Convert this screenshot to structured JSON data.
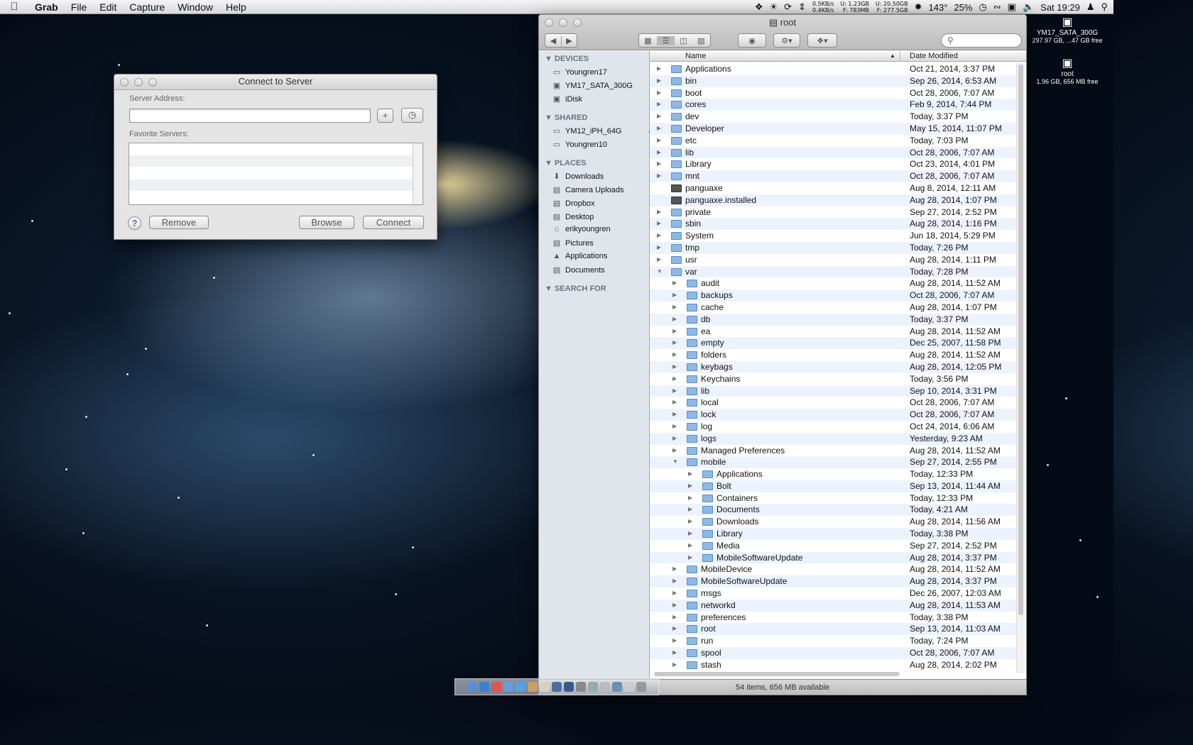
{
  "menubar": {
    "apple_icon": "apple-logo",
    "app_name": "Grab",
    "menus": [
      "File",
      "Edit",
      "Capture",
      "Window",
      "Help"
    ],
    "status": {
      "net_up": "0.5KB/s",
      "net_down": "0.4KB/s",
      "mem_u": "U:  1.23GB",
      "mem_f": "F:  783MB",
      "disk_u": "U:  20.50GB",
      "disk_f": "F:  277.5GB",
      "temp": "143°",
      "battery": "25%",
      "clock": "Sat 19:29"
    }
  },
  "desktop_icons": [
    {
      "name": "YM17_SATA_300G",
      "sub": "297.97 GB, ...47 GB free"
    },
    {
      "name": "root",
      "sub": "1.96 GB, 656 MB free"
    }
  ],
  "connect_dialog": {
    "title": "Connect to Server",
    "server_address_label": "Server Address:",
    "server_address_value": "",
    "favorite_servers_label": "Favorite Servers:",
    "add_label": "+",
    "help_label": "?",
    "remove_label": "Remove",
    "browse_label": "Browse",
    "connect_label": "Connect"
  },
  "finder": {
    "title": "root",
    "search_placeholder": "",
    "sidebar": {
      "devices_header": "DEVICES",
      "devices": [
        "Youngren17",
        "YM17_SATA_300G",
        "iDisk"
      ],
      "shared_header": "SHARED",
      "shared": [
        "YM12_iPH_64G",
        "Youngren10"
      ],
      "places_header": "PLACES",
      "places": [
        "Downloads",
        "Camera Uploads",
        "Dropbox",
        "Desktop",
        "erikyoungren",
        "Pictures",
        "Applications",
        "Documents"
      ],
      "search_header": "SEARCH FOR"
    },
    "columns": {
      "name": "Name",
      "date": "Date Modified"
    },
    "rows": [
      {
        "name": "Applications",
        "date": "Oct 21, 2014, 3:37 PM",
        "level": 0,
        "state": "closed"
      },
      {
        "name": "bin",
        "date": "Sep 26, 2014, 6:53 AM",
        "level": 0,
        "state": "closed"
      },
      {
        "name": "boot",
        "date": "Oct 28, 2006, 7:07 AM",
        "level": 0,
        "state": "closed"
      },
      {
        "name": "cores",
        "date": "Feb 9, 2014, 7:44 PM",
        "level": 0,
        "state": "closed"
      },
      {
        "name": "dev",
        "date": "Today, 3:37 PM",
        "level": 0,
        "state": "closed"
      },
      {
        "name": "Developer",
        "date": "May 15, 2014, 11:07 PM",
        "level": 0,
        "state": "closed"
      },
      {
        "name": "etc",
        "date": "Today, 7:03 PM",
        "level": 0,
        "state": "closed"
      },
      {
        "name": "lib",
        "date": "Oct 28, 2006, 7:07 AM",
        "level": 0,
        "state": "closed"
      },
      {
        "name": "Library",
        "date": "Oct 23, 2014, 4:01 PM",
        "level": 0,
        "state": "closed"
      },
      {
        "name": "mnt",
        "date": "Oct 28, 2006, 7:07 AM",
        "level": 0,
        "state": "closed"
      },
      {
        "name": "panguaxe",
        "date": "Aug 8, 2014, 12:11 AM",
        "level": 0,
        "state": "file"
      },
      {
        "name": "panguaxe.installed",
        "date": "Aug 28, 2014, 1:07 PM",
        "level": 0,
        "state": "file"
      },
      {
        "name": "private",
        "date": "Sep 27, 2014, 2:52 PM",
        "level": 0,
        "state": "closed"
      },
      {
        "name": "sbin",
        "date": "Aug 28, 2014, 1:16 PM",
        "level": 0,
        "state": "closed"
      },
      {
        "name": "System",
        "date": "Jun 18, 2014, 5:29 PM",
        "level": 0,
        "state": "closed"
      },
      {
        "name": "tmp",
        "date": "Today, 7:26 PM",
        "level": 0,
        "state": "closed"
      },
      {
        "name": "usr",
        "date": "Aug 28, 2014, 1:11 PM",
        "level": 0,
        "state": "closed"
      },
      {
        "name": "var",
        "date": "Today, 7:28 PM",
        "level": 0,
        "state": "open"
      },
      {
        "name": "audit",
        "date": "Aug 28, 2014, 11:52 AM",
        "level": 1,
        "state": "closed"
      },
      {
        "name": "backups",
        "date": "Oct 28, 2006, 7:07 AM",
        "level": 1,
        "state": "closed"
      },
      {
        "name": "cache",
        "date": "Aug 28, 2014, 1:07 PM",
        "level": 1,
        "state": "closed"
      },
      {
        "name": "db",
        "date": "Today, 3:37 PM",
        "level": 1,
        "state": "closed"
      },
      {
        "name": "ea",
        "date": "Aug 28, 2014, 11:52 AM",
        "level": 1,
        "state": "closed"
      },
      {
        "name": "empty",
        "date": "Dec 25, 2007, 11:58 PM",
        "level": 1,
        "state": "closed"
      },
      {
        "name": "folders",
        "date": "Aug 28, 2014, 11:52 AM",
        "level": 1,
        "state": "closed"
      },
      {
        "name": "keybags",
        "date": "Aug 28, 2014, 12:05 PM",
        "level": 1,
        "state": "closed"
      },
      {
        "name": "Keychains",
        "date": "Today, 3:56 PM",
        "level": 1,
        "state": "closed"
      },
      {
        "name": "lib",
        "date": "Sep 10, 2014, 3:31 PM",
        "level": 1,
        "state": "closed"
      },
      {
        "name": "local",
        "date": "Oct 28, 2006, 7:07 AM",
        "level": 1,
        "state": "closed"
      },
      {
        "name": "lock",
        "date": "Oct 28, 2006, 7:07 AM",
        "level": 1,
        "state": "closed"
      },
      {
        "name": "log",
        "date": "Oct 24, 2014, 6:06 AM",
        "level": 1,
        "state": "closed"
      },
      {
        "name": "logs",
        "date": "Yesterday, 9:23 AM",
        "level": 1,
        "state": "closed"
      },
      {
        "name": "Managed Preferences",
        "date": "Aug 28, 2014, 11:52 AM",
        "level": 1,
        "state": "closed"
      },
      {
        "name": "mobile",
        "date": "Sep 27, 2014, 2:55 PM",
        "level": 1,
        "state": "open"
      },
      {
        "name": "Applications",
        "date": "Today, 12:33 PM",
        "level": 2,
        "state": "closed"
      },
      {
        "name": "Bolt",
        "date": "Sep 13, 2014, 11:44 AM",
        "level": 2,
        "state": "closed"
      },
      {
        "name": "Containers",
        "date": "Today, 12:33 PM",
        "level": 2,
        "state": "closed"
      },
      {
        "name": "Documents",
        "date": "Today, 4:21 AM",
        "level": 2,
        "state": "closed"
      },
      {
        "name": "Downloads",
        "date": "Aug 28, 2014, 11:56 AM",
        "level": 2,
        "state": "closed"
      },
      {
        "name": "Library",
        "date": "Today, 3:38 PM",
        "level": 2,
        "state": "closed"
      },
      {
        "name": "Media",
        "date": "Sep 27, 2014, 2:52 PM",
        "level": 2,
        "state": "closed"
      },
      {
        "name": "MobileSoftwareUpdate",
        "date": "Aug 28, 2014, 3:37 PM",
        "level": 2,
        "state": "closed"
      },
      {
        "name": "MobileDevice",
        "date": "Aug 28, 2014, 11:52 AM",
        "level": 1,
        "state": "closed"
      },
      {
        "name": "MobileSoftwareUpdate",
        "date": "Aug 28, 2014, 3:37 PM",
        "level": 1,
        "state": "closed"
      },
      {
        "name": "msgs",
        "date": "Dec 26, 2007, 12:03 AM",
        "level": 1,
        "state": "closed"
      },
      {
        "name": "networkd",
        "date": "Aug 28, 2014, 11:53 AM",
        "level": 1,
        "state": "closed"
      },
      {
        "name": "preferences",
        "date": "Today, 3:38 PM",
        "level": 1,
        "state": "closed"
      },
      {
        "name": "root",
        "date": "Sep 13, 2014, 11:03 AM",
        "level": 1,
        "state": "closed"
      },
      {
        "name": "run",
        "date": "Today, 7:24 PM",
        "level": 1,
        "state": "closed"
      },
      {
        "name": "spool",
        "date": "Oct 28, 2006, 7:07 AM",
        "level": 1,
        "state": "closed"
      },
      {
        "name": "stash",
        "date": "Aug 28, 2014, 2:02 PM",
        "level": 1,
        "state": "closed"
      }
    ],
    "status_text": "54 items, 656 MB available"
  }
}
